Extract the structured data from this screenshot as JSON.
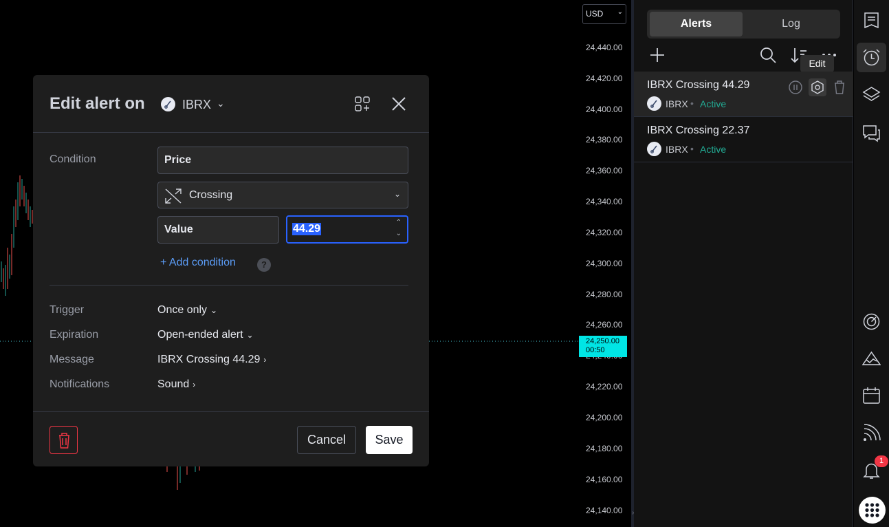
{
  "chart": {
    "currency": "USD",
    "price_ticks": [
      "24,440.00",
      "24,420.00",
      "24,400.00",
      "24,380.00",
      "24,360.00",
      "24,340.00",
      "24,320.00",
      "24,300.00",
      "24,280.00",
      "24,260.00",
      "24,240.00",
      "24,220.00",
      "24,200.00",
      "24,180.00",
      "24,160.00",
      "24,140.00"
    ],
    "current_price": "24,250.00",
    "countdown": "00:50"
  },
  "dialog": {
    "title": "Edit alert on",
    "symbol": "IBRX",
    "condition_label": "Condition",
    "condition_source": "Price",
    "condition_operator": "Crossing",
    "value_type": "Value",
    "value": "44.29",
    "add_condition": "Add condition",
    "trigger_label": "Trigger",
    "trigger_value": "Once only",
    "expiration_label": "Expiration",
    "expiration_value": "Open-ended alert",
    "message_label": "Message",
    "message_value": "IBRX Crossing 44.29",
    "notifications_label": "Notifications",
    "notifications_value": "Sound",
    "cancel_label": "Cancel",
    "save_label": "Save"
  },
  "panel": {
    "tabs": [
      {
        "label": "Alerts",
        "active": true
      },
      {
        "label": "Log",
        "active": false
      }
    ],
    "tooltip": "Edit",
    "alerts": [
      {
        "title": "IBRX Crossing 44.29",
        "symbol": "IBRX",
        "status": "Active"
      },
      {
        "title": "IBRX Crossing 22.37",
        "symbol": "IBRX",
        "status": "Active"
      }
    ]
  },
  "sidebar": {
    "notification_count": "1",
    "icons": [
      "watchlist-icon",
      "alarm-clock-icon",
      "layers-icon",
      "chat-icon",
      "gauge-icon",
      "mountain-chart-icon",
      "calendar-icon",
      "rss-icon",
      "bell-icon",
      "apps-grid-icon"
    ]
  },
  "colors": {
    "accent": "#2962ff",
    "active_status": "#22ab94",
    "danger": "#f23645",
    "price_tag": "#00e5e5"
  }
}
